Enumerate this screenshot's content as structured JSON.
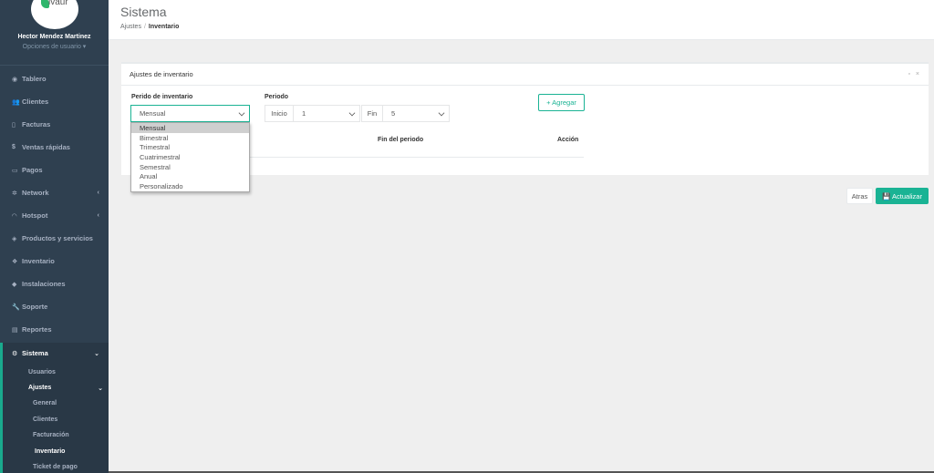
{
  "brand": {
    "logo_text": "ivaur"
  },
  "user": {
    "name": "Hector Mendez Martinez",
    "options": "Opciones de usuario ▾"
  },
  "sidebar": {
    "items": [
      {
        "label": "Tablero",
        "icon": "tachometer-icon",
        "glyph": "◉"
      },
      {
        "label": "Clientes",
        "icon": "users-icon",
        "glyph": "👥"
      },
      {
        "label": "Facturas",
        "icon": "file-icon",
        "glyph": "▯"
      },
      {
        "label": "Ventas rápidas",
        "icon": "dollar-icon",
        "glyph": "$"
      },
      {
        "label": "Pagos",
        "icon": "money-icon",
        "glyph": "▭"
      },
      {
        "label": "Network",
        "icon": "sitemap-icon",
        "glyph": "✲"
      },
      {
        "label": "Hotspot",
        "icon": "wifi-icon",
        "glyph": "◠"
      },
      {
        "label": "Productos y servicios",
        "icon": "tags-icon",
        "glyph": "◈"
      },
      {
        "label": "Inventario",
        "icon": "cubes-icon",
        "glyph": "❖"
      },
      {
        "label": "Instalaciones",
        "icon": "diamond-icon",
        "glyph": "◆"
      },
      {
        "label": "Soporte",
        "icon": "wrench-icon",
        "glyph": "🔧"
      },
      {
        "label": "Reportes",
        "icon": "book-icon",
        "glyph": "▤"
      }
    ],
    "sistema": {
      "label": "Sistema",
      "glyph": "⚙"
    },
    "sub": {
      "usuarios": "Usuarios",
      "ajustes": "Ajustes"
    },
    "ajustes_items": [
      "General",
      "Clientes",
      "Facturación",
      "Inventario",
      "Ticket de pago"
    ]
  },
  "header": {
    "title": "Sistema",
    "crumb_parent": "Ajustes",
    "crumb_sep": "/",
    "crumb_current": "Inventario"
  },
  "panel": {
    "title": "Ajustes de inventario",
    "tools": "▫ ×",
    "periodo_inv_label": "Perido de inventario",
    "periodo_label": "Periodo",
    "selected_period": "Mensual",
    "inicio_label": "Inicio",
    "inicio_value": "1",
    "fin_label": "Fin",
    "fin_value": "5",
    "add_button": "+ Agregar",
    "col_fin": "Fin del periodo",
    "col_accion": "Acción"
  },
  "dropdown_options": [
    "Mensual",
    "Bimestral",
    "Trimestral",
    "Cuatrimestral",
    "Semestral",
    "Anual",
    "Personalizado"
  ],
  "actions": {
    "back": "Atras",
    "update": "💾 Actualizar"
  },
  "colors": {
    "sidebar_bg": "#2f4050",
    "accent": "#1ab394"
  }
}
